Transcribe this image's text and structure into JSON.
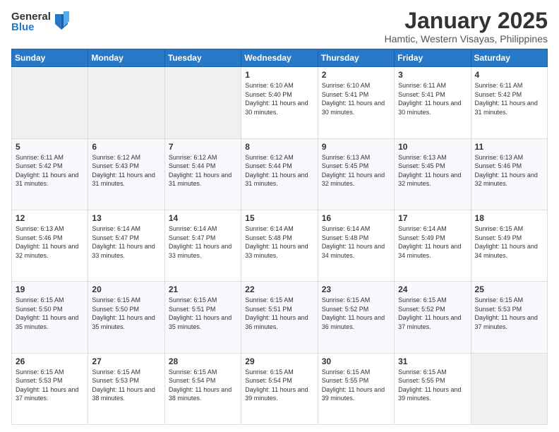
{
  "logo": {
    "general": "General",
    "blue": "Blue"
  },
  "title": "January 2025",
  "location": "Hamtic, Western Visayas, Philippines",
  "days_header": [
    "Sunday",
    "Monday",
    "Tuesday",
    "Wednesday",
    "Thursday",
    "Friday",
    "Saturday"
  ],
  "weeks": [
    [
      {
        "day": "",
        "info": ""
      },
      {
        "day": "",
        "info": ""
      },
      {
        "day": "",
        "info": ""
      },
      {
        "day": "1",
        "info": "Sunrise: 6:10 AM\nSunset: 5:40 PM\nDaylight: 11 hours and 30 minutes."
      },
      {
        "day": "2",
        "info": "Sunrise: 6:10 AM\nSunset: 5:41 PM\nDaylight: 11 hours and 30 minutes."
      },
      {
        "day": "3",
        "info": "Sunrise: 6:11 AM\nSunset: 5:41 PM\nDaylight: 11 hours and 30 minutes."
      },
      {
        "day": "4",
        "info": "Sunrise: 6:11 AM\nSunset: 5:42 PM\nDaylight: 11 hours and 31 minutes."
      }
    ],
    [
      {
        "day": "5",
        "info": "Sunrise: 6:11 AM\nSunset: 5:42 PM\nDaylight: 11 hours and 31 minutes."
      },
      {
        "day": "6",
        "info": "Sunrise: 6:12 AM\nSunset: 5:43 PM\nDaylight: 11 hours and 31 minutes."
      },
      {
        "day": "7",
        "info": "Sunrise: 6:12 AM\nSunset: 5:44 PM\nDaylight: 11 hours and 31 minutes."
      },
      {
        "day": "8",
        "info": "Sunrise: 6:12 AM\nSunset: 5:44 PM\nDaylight: 11 hours and 31 minutes."
      },
      {
        "day": "9",
        "info": "Sunrise: 6:13 AM\nSunset: 5:45 PM\nDaylight: 11 hours and 32 minutes."
      },
      {
        "day": "10",
        "info": "Sunrise: 6:13 AM\nSunset: 5:45 PM\nDaylight: 11 hours and 32 minutes."
      },
      {
        "day": "11",
        "info": "Sunrise: 6:13 AM\nSunset: 5:46 PM\nDaylight: 11 hours and 32 minutes."
      }
    ],
    [
      {
        "day": "12",
        "info": "Sunrise: 6:13 AM\nSunset: 5:46 PM\nDaylight: 11 hours and 32 minutes."
      },
      {
        "day": "13",
        "info": "Sunrise: 6:14 AM\nSunset: 5:47 PM\nDaylight: 11 hours and 33 minutes."
      },
      {
        "day": "14",
        "info": "Sunrise: 6:14 AM\nSunset: 5:47 PM\nDaylight: 11 hours and 33 minutes."
      },
      {
        "day": "15",
        "info": "Sunrise: 6:14 AM\nSunset: 5:48 PM\nDaylight: 11 hours and 33 minutes."
      },
      {
        "day": "16",
        "info": "Sunrise: 6:14 AM\nSunset: 5:48 PM\nDaylight: 11 hours and 34 minutes."
      },
      {
        "day": "17",
        "info": "Sunrise: 6:14 AM\nSunset: 5:49 PM\nDaylight: 11 hours and 34 minutes."
      },
      {
        "day": "18",
        "info": "Sunrise: 6:15 AM\nSunset: 5:49 PM\nDaylight: 11 hours and 34 minutes."
      }
    ],
    [
      {
        "day": "19",
        "info": "Sunrise: 6:15 AM\nSunset: 5:50 PM\nDaylight: 11 hours and 35 minutes."
      },
      {
        "day": "20",
        "info": "Sunrise: 6:15 AM\nSunset: 5:50 PM\nDaylight: 11 hours and 35 minutes."
      },
      {
        "day": "21",
        "info": "Sunrise: 6:15 AM\nSunset: 5:51 PM\nDaylight: 11 hours and 35 minutes."
      },
      {
        "day": "22",
        "info": "Sunrise: 6:15 AM\nSunset: 5:51 PM\nDaylight: 11 hours and 36 minutes."
      },
      {
        "day": "23",
        "info": "Sunrise: 6:15 AM\nSunset: 5:52 PM\nDaylight: 11 hours and 36 minutes."
      },
      {
        "day": "24",
        "info": "Sunrise: 6:15 AM\nSunset: 5:52 PM\nDaylight: 11 hours and 37 minutes."
      },
      {
        "day": "25",
        "info": "Sunrise: 6:15 AM\nSunset: 5:53 PM\nDaylight: 11 hours and 37 minutes."
      }
    ],
    [
      {
        "day": "26",
        "info": "Sunrise: 6:15 AM\nSunset: 5:53 PM\nDaylight: 11 hours and 37 minutes."
      },
      {
        "day": "27",
        "info": "Sunrise: 6:15 AM\nSunset: 5:53 PM\nDaylight: 11 hours and 38 minutes."
      },
      {
        "day": "28",
        "info": "Sunrise: 6:15 AM\nSunset: 5:54 PM\nDaylight: 11 hours and 38 minutes."
      },
      {
        "day": "29",
        "info": "Sunrise: 6:15 AM\nSunset: 5:54 PM\nDaylight: 11 hours and 39 minutes."
      },
      {
        "day": "30",
        "info": "Sunrise: 6:15 AM\nSunset: 5:55 PM\nDaylight: 11 hours and 39 minutes."
      },
      {
        "day": "31",
        "info": "Sunrise: 6:15 AM\nSunset: 5:55 PM\nDaylight: 11 hours and 39 minutes."
      },
      {
        "day": "",
        "info": ""
      }
    ]
  ]
}
